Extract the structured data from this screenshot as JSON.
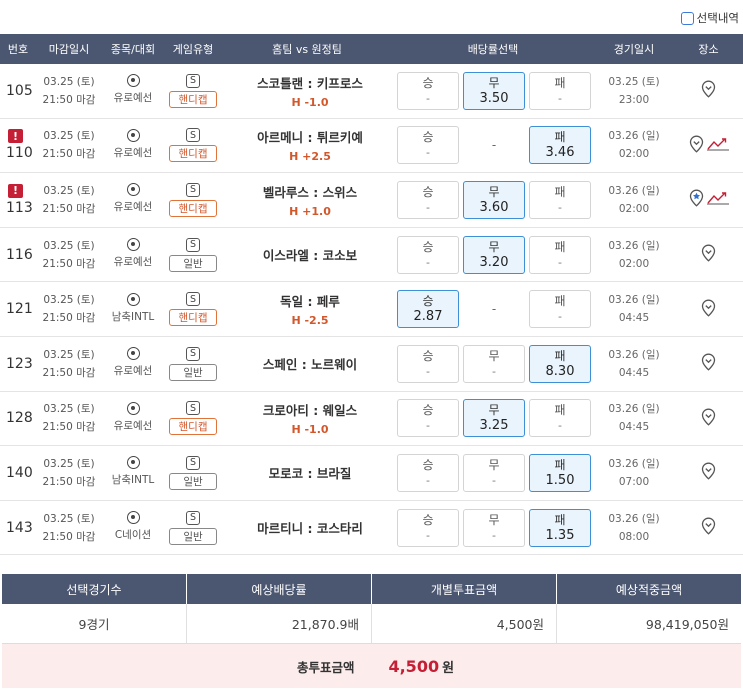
{
  "top": {
    "selection_toggle_label": "선택내역"
  },
  "headers": {
    "no": "번호",
    "close_time": "마감일시",
    "league": "종목/대회",
    "game_type": "게임유형",
    "match": "홈팀 vs 원정팀",
    "odds": "배당률선택",
    "game_date": "경기일시",
    "place": "장소"
  },
  "rows": [
    {
      "no": "105",
      "warn": false,
      "close_date": "03.25 (토)",
      "close_time": "21:50 마감",
      "league": "유로예선",
      "type_badge": "S",
      "type": "핸디캡",
      "type_kind": "hc",
      "match": "스코틀랜 : 키프로스",
      "handicap": "H -1.0",
      "odds": [
        {
          "label": "승",
          "value": "-",
          "state": "normal"
        },
        {
          "label": "무",
          "value": "3.50",
          "state": "selected"
        },
        {
          "label": "패",
          "value": "-",
          "state": "normal"
        }
      ],
      "game_date": "03.25 (토)",
      "game_time": "23:00",
      "place_icons": [
        "location-pin"
      ]
    },
    {
      "no": "110",
      "warn": true,
      "warn_mark": "!",
      "close_date": "03.25 (토)",
      "close_time": "21:50 마감",
      "league": "유로예선",
      "type_badge": "S",
      "type": "핸디캡",
      "type_kind": "hc",
      "match": "아르메니 : 튀르키예",
      "handicap": "H +2.5",
      "odds": [
        {
          "label": "승",
          "value": "-",
          "state": "normal"
        },
        {
          "label": "",
          "value": "-",
          "state": "empty"
        },
        {
          "label": "패",
          "value": "3.46",
          "state": "selected"
        }
      ],
      "game_date": "03.26 (일)",
      "game_time": "02:00",
      "place_icons": [
        "location-pin",
        "trend-chart"
      ]
    },
    {
      "no": "113",
      "warn": true,
      "warn_mark": "!",
      "close_date": "03.25 (토)",
      "close_time": "21:50 마감",
      "league": "유로예선",
      "type_badge": "S",
      "type": "핸디캡",
      "type_kind": "hc",
      "match": "벨라루스 : 스위스",
      "handicap": "H +1.0",
      "odds": [
        {
          "label": "승",
          "value": "-",
          "state": "normal"
        },
        {
          "label": "무",
          "value": "3.60",
          "state": "selected"
        },
        {
          "label": "패",
          "value": "-",
          "state": "normal"
        }
      ],
      "game_date": "03.26 (일)",
      "game_time": "02:00",
      "place_icons": [
        "location-pin-star",
        "trend-chart"
      ]
    },
    {
      "no": "116",
      "warn": false,
      "close_date": "03.25 (토)",
      "close_time": "21:50 마감",
      "league": "유로예선",
      "type_badge": "S",
      "type": "일반",
      "type_kind": "gen",
      "match": "이스라엘 : 코소보",
      "handicap": "",
      "odds": [
        {
          "label": "승",
          "value": "-",
          "state": "normal"
        },
        {
          "label": "무",
          "value": "3.20",
          "state": "selected"
        },
        {
          "label": "패",
          "value": "-",
          "state": "normal"
        }
      ],
      "game_date": "03.26 (일)",
      "game_time": "02:00",
      "place_icons": [
        "location-pin"
      ]
    },
    {
      "no": "121",
      "warn": false,
      "close_date": "03.25 (토)",
      "close_time": "21:50 마감",
      "league": "남축INTL",
      "type_badge": "S",
      "type": "핸디캡",
      "type_kind": "hc",
      "match": "독일 : 페루",
      "handicap": "H -2.5",
      "odds": [
        {
          "label": "승",
          "value": "2.87",
          "state": "selected"
        },
        {
          "label": "",
          "value": "-",
          "state": "empty"
        },
        {
          "label": "패",
          "value": "-",
          "state": "normal"
        }
      ],
      "game_date": "03.26 (일)",
      "game_time": "04:45",
      "place_icons": [
        "location-pin"
      ]
    },
    {
      "no": "123",
      "warn": false,
      "close_date": "03.25 (토)",
      "close_time": "21:50 마감",
      "league": "유로예선",
      "type_badge": "S",
      "type": "일반",
      "type_kind": "gen",
      "match": "스페인 : 노르웨이",
      "handicap": "",
      "odds": [
        {
          "label": "승",
          "value": "-",
          "state": "normal"
        },
        {
          "label": "무",
          "value": "-",
          "state": "normal"
        },
        {
          "label": "패",
          "value": "8.30",
          "state": "selected"
        }
      ],
      "game_date": "03.26 (일)",
      "game_time": "04:45",
      "place_icons": [
        "location-pin"
      ]
    },
    {
      "no": "128",
      "warn": false,
      "close_date": "03.25 (토)",
      "close_time": "21:50 마감",
      "league": "유로예선",
      "type_badge": "S",
      "type": "핸디캡",
      "type_kind": "hc",
      "match": "크로아티 : 웨일스",
      "handicap": "H -1.0",
      "odds": [
        {
          "label": "승",
          "value": "-",
          "state": "normal"
        },
        {
          "label": "무",
          "value": "3.25",
          "state": "selected"
        },
        {
          "label": "패",
          "value": "-",
          "state": "normal"
        }
      ],
      "game_date": "03.26 (일)",
      "game_time": "04:45",
      "place_icons": [
        "location-pin"
      ]
    },
    {
      "no": "140",
      "warn": false,
      "close_date": "03.25 (토)",
      "close_time": "21:50 마감",
      "league": "남축INTL",
      "type_badge": "S",
      "type": "일반",
      "type_kind": "gen",
      "match": "모로코 : 브라질",
      "handicap": "",
      "odds": [
        {
          "label": "승",
          "value": "-",
          "state": "normal"
        },
        {
          "label": "무",
          "value": "-",
          "state": "normal"
        },
        {
          "label": "패",
          "value": "1.50",
          "state": "selected"
        }
      ],
      "game_date": "03.26 (일)",
      "game_time": "07:00",
      "place_icons": [
        "location-pin"
      ]
    },
    {
      "no": "143",
      "warn": false,
      "close_date": "03.25 (토)",
      "close_time": "21:50 마감",
      "league": "C네이션",
      "type_badge": "S",
      "type": "일반",
      "type_kind": "gen",
      "match": "마르티니 : 코스타리",
      "handicap": "",
      "odds": [
        {
          "label": "승",
          "value": "-",
          "state": "normal"
        },
        {
          "label": "무",
          "value": "-",
          "state": "normal"
        },
        {
          "label": "패",
          "value": "1.35",
          "state": "selected"
        }
      ],
      "game_date": "03.26 (일)",
      "game_time": "08:00",
      "place_icons": [
        "location-pin"
      ]
    }
  ],
  "summary": {
    "headers": [
      "선택경기수",
      "예상배당률",
      "개별투표금액",
      "예상적중금액"
    ],
    "values": [
      "9경기",
      "21,870.9배",
      "4,500원",
      "98,419,050원"
    ],
    "total_label": "총투표금액",
    "total_value": "4,500",
    "total_unit": "원"
  },
  "colors": {
    "header_bg": "#4b5670",
    "handicap": "#d2572b",
    "selected_bg": "#eaf4fc",
    "selected_border": "#3d8fd6",
    "warn": "#c51f35",
    "total_bg": "#fcecec"
  }
}
